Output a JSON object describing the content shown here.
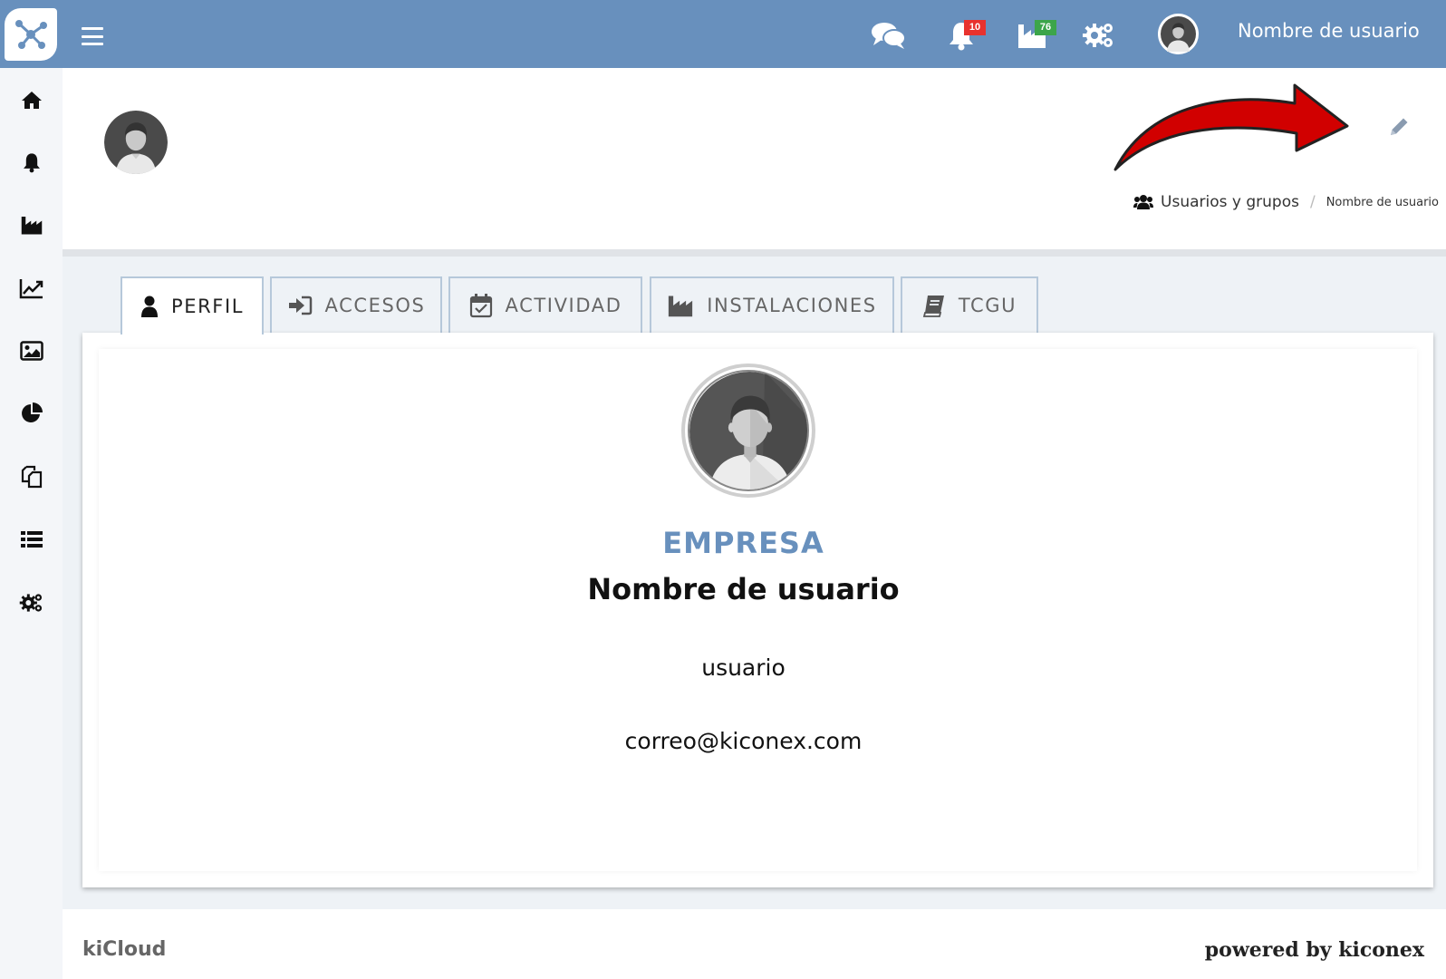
{
  "topbar": {
    "menu_label": "menu",
    "chat_icon": "chat-icon",
    "notifications_count": "10",
    "installations_count": "76",
    "settings_icon": "gear-icon",
    "username": "Nombre de usuario"
  },
  "sidebar": {
    "items": [
      {
        "icon": "home-icon"
      },
      {
        "icon": "bell-icon"
      },
      {
        "icon": "factory-icon"
      },
      {
        "icon": "line-chart-icon"
      },
      {
        "icon": "image-icon"
      },
      {
        "icon": "pie-chart-icon"
      },
      {
        "icon": "copy-icon"
      },
      {
        "icon": "list-icon"
      },
      {
        "icon": "gears-icon"
      }
    ]
  },
  "breadcrumb": {
    "parent": "Usuarios y grupos",
    "separator": "/",
    "current": "Nombre de usuario"
  },
  "tabs": [
    {
      "label": "PERFIL",
      "icon": "user-icon",
      "active": true
    },
    {
      "label": "ACCESOS",
      "icon": "sign-in-icon",
      "active": false
    },
    {
      "label": "ACTIVIDAD",
      "icon": "calendar-check-icon",
      "active": false
    },
    {
      "label": "INSTALACIONES",
      "icon": "factory-icon",
      "active": false
    },
    {
      "label": "TCGU",
      "icon": "book-icon",
      "active": false
    }
  ],
  "profile": {
    "company": "EMPRESA",
    "full_name": "Nombre de usuario",
    "username": "usuario",
    "email": "correo@kiconex.com"
  },
  "footer": {
    "left": "kiCloud",
    "right": "powered by kiconex"
  },
  "colors": {
    "topbar": "#6890bd",
    "accent": "#6890bd",
    "arrow": "#d10000",
    "badge_red": "#e8322e",
    "badge_green": "#3ca54a"
  }
}
